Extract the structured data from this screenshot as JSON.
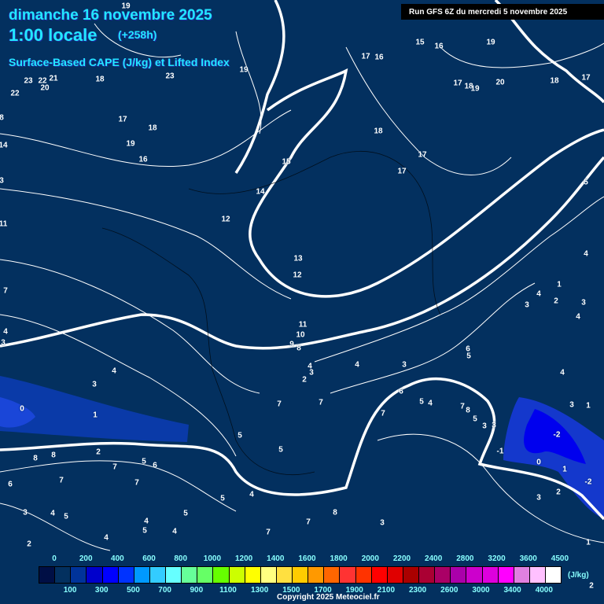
{
  "header": {
    "date": "dimanche 16 novembre 2025",
    "time": "1:00 locale",
    "lead": "(+258h)",
    "parameter": "Surface-Based CAPE (J/kg) et Lifted Index",
    "run": "Run GFS 6Z du mercredi 5 novembre 2025"
  },
  "contour_labels": [
    "19",
    "17",
    "16",
    "15",
    "16",
    "19",
    "17",
    "18",
    "19",
    "20",
    "18",
    "17",
    "23",
    "22",
    "21",
    "22",
    "20",
    "18",
    "23",
    "19",
    "17",
    "18",
    "19",
    "16",
    "18",
    "17",
    "17",
    "15",
    "14",
    "12",
    "13",
    "12",
    "11",
    "10",
    "9",
    "8",
    "4",
    "3",
    "2",
    "4",
    "3",
    "6",
    "5",
    "4",
    "7",
    "7",
    "7",
    "5",
    "5",
    "4",
    "3",
    "1",
    "0",
    "2",
    "8",
    "8",
    "7",
    "5",
    "6",
    "7",
    "6",
    "7",
    "5",
    "4",
    "3",
    "4",
    "5",
    "4",
    "5",
    "5",
    "4",
    "4",
    "2",
    "7",
    "7",
    "8",
    "3",
    "6",
    "5",
    "8",
    "7",
    "5",
    "3",
    "3",
    "4",
    "2",
    "3",
    "1",
    "3",
    "4",
    "4",
    "5",
    "4",
    "3",
    "1",
    "-2",
    "-1",
    "0",
    "1",
    "-2",
    "3",
    "2",
    "1",
    "2",
    "7",
    "4",
    "3",
    "11",
    "3",
    "14",
    "8"
  ],
  "colorbar": {
    "unit": "(J/kg)",
    "colors": [
      "#000f45",
      "#03305f",
      "#00339a",
      "#0000cc",
      "#0000ff",
      "#0033ff",
      "#0099ff",
      "#33ccff",
      "#66ffff",
      "#66ff99",
      "#66ff66",
      "#66ff00",
      "#ccff00",
      "#ffff00",
      "#ffff80",
      "#ffe040",
      "#ffcc00",
      "#ff9900",
      "#ff6600",
      "#ff3333",
      "#ff3300",
      "#ff0000",
      "#e00000",
      "#aa0000",
      "#aa0033",
      "#aa0066",
      "#aa00aa",
      "#cc00cc",
      "#dd00dd",
      "#ff00ff",
      "#e080e0",
      "#ffc0ff",
      "#ffffff"
    ],
    "top_labels": [
      "0",
      "200",
      "400",
      "600",
      "800",
      "1000",
      "1200",
      "1400",
      "1600",
      "1800",
      "2000",
      "2200",
      "2400",
      "2800",
      "3200",
      "3600",
      "4500"
    ],
    "bottom_labels": [
      "100",
      "300",
      "500",
      "700",
      "900",
      "1100",
      "1300",
      "1500",
      "1700",
      "1900",
      "2100",
      "2300",
      "2600",
      "3000",
      "3400",
      "4000"
    ]
  },
  "copyright": "Copyright 2025 Meteociel.fr"
}
